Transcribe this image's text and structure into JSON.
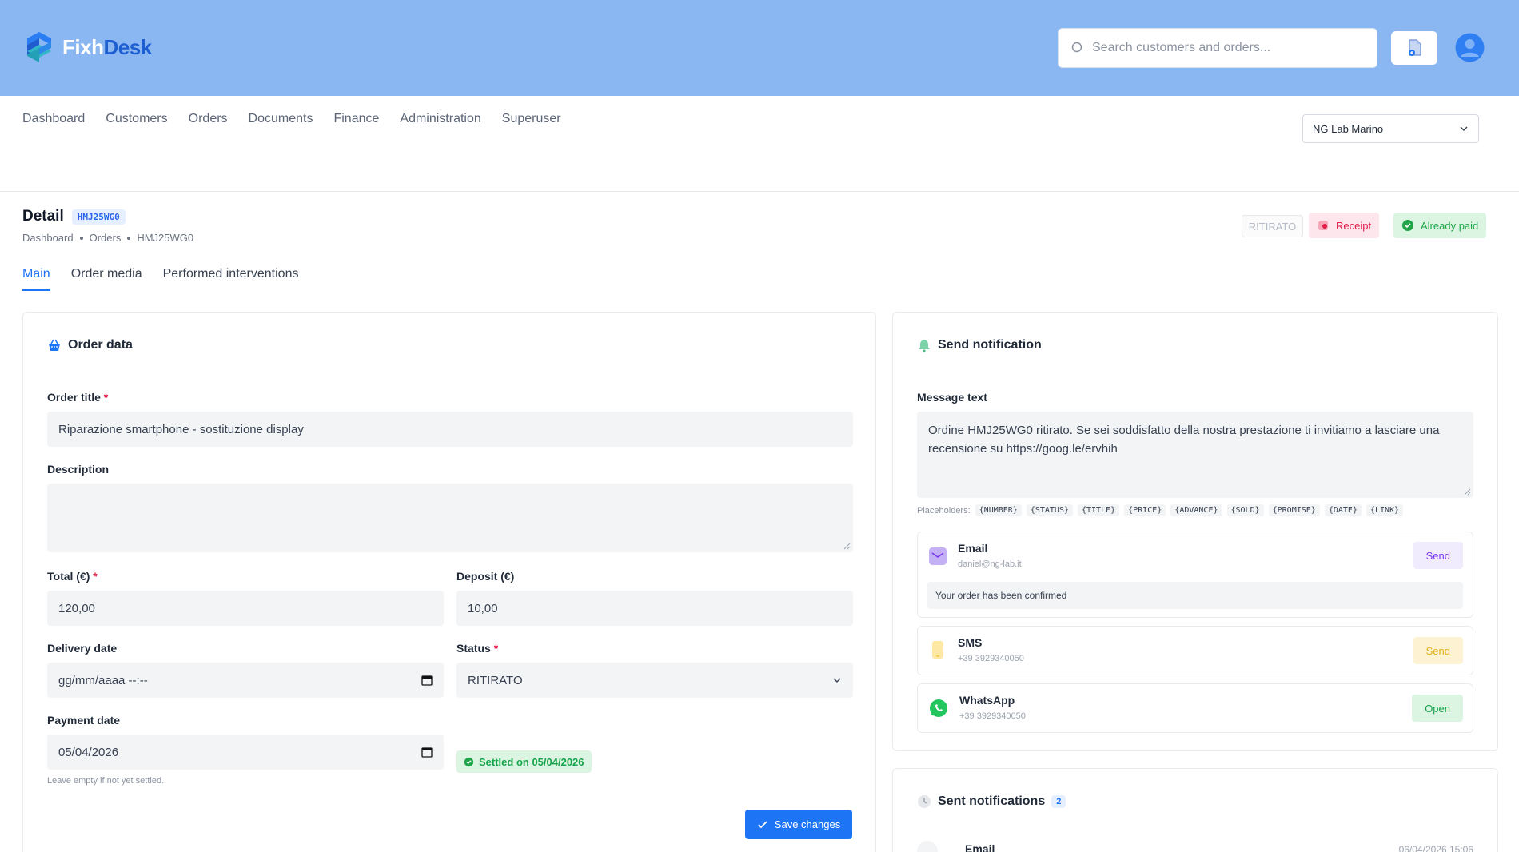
{
  "brand": {
    "name_part1": "Fixh",
    "name_part2": "Desk"
  },
  "search": {
    "placeholder": "Search customers and orders..."
  },
  "nav": [
    "Dashboard",
    "Customers",
    "Orders",
    "Documents",
    "Finance",
    "Administration",
    "Superuser"
  ],
  "shop_selector": {
    "value": "NG Lab Marino"
  },
  "detail": {
    "title": "Detail",
    "code": "HMJ25WG0",
    "breadcrumb": [
      "Dashboard",
      "Orders",
      "HMJ25WG0"
    ],
    "status_label": "RITIRATO",
    "receipt_label": "Receipt",
    "paid_label": "Already paid"
  },
  "tabs": [
    "Main",
    "Order media",
    "Performed interventions"
  ],
  "order_data": {
    "heading": "Order data",
    "title_label": "Order title",
    "title_value": "Riparazione smartphone - sostituzione display",
    "description_label": "Description",
    "description_value": "",
    "total_label": "Total (€)",
    "total_value": "120,00",
    "deposit_label": "Deposit (€)",
    "deposit_value": "10,00",
    "delivery_label": "Delivery date",
    "delivery_value": "gg/mm/aaaa --:--",
    "status_label": "Status",
    "status_value": "RITIRATO",
    "payment_label": "Payment date",
    "payment_value": "05/04/2026",
    "payment_hint": "Leave empty if not yet settled.",
    "settled_text": "Settled on 05/04/2026",
    "save_label": "Save changes",
    "required_mark": "*"
  },
  "notification": {
    "heading": "Send notification",
    "message_label": "Message text",
    "message_value": "Ordine HMJ25WG0 ritirato. Se sei soddisfatto della nostra prestazione ti invitiamo a lasciare una recensione su https://goog.le/ervhih",
    "placeholders_label": "Placeholders:",
    "placeholders": [
      "{NUMBER}",
      "{STATUS}",
      "{TITLE}",
      "{PRICE}",
      "{ADVANCE}",
      "{SOLD}",
      "{PROMISE}",
      "{DATE}",
      "{LINK}"
    ],
    "channels": [
      {
        "name": "Email",
        "sub": "daniel@ng-lab.it",
        "button": "Send",
        "message": "Your order has been confirmed"
      },
      {
        "name": "SMS",
        "sub": "+39 3929340050",
        "button": "Send"
      },
      {
        "name": "WhatsApp",
        "sub": "+39 3929340050",
        "button": "Open"
      }
    ]
  },
  "sent": {
    "heading": "Sent notifications",
    "count": "2",
    "first_item_name": "Email",
    "first_item_time": "06/04/2026 15:06"
  },
  "colors": {
    "header_bg": "#8ab6f2",
    "accent": "#1d74f5",
    "success": "#16a34a",
    "danger": "#e11d48"
  }
}
